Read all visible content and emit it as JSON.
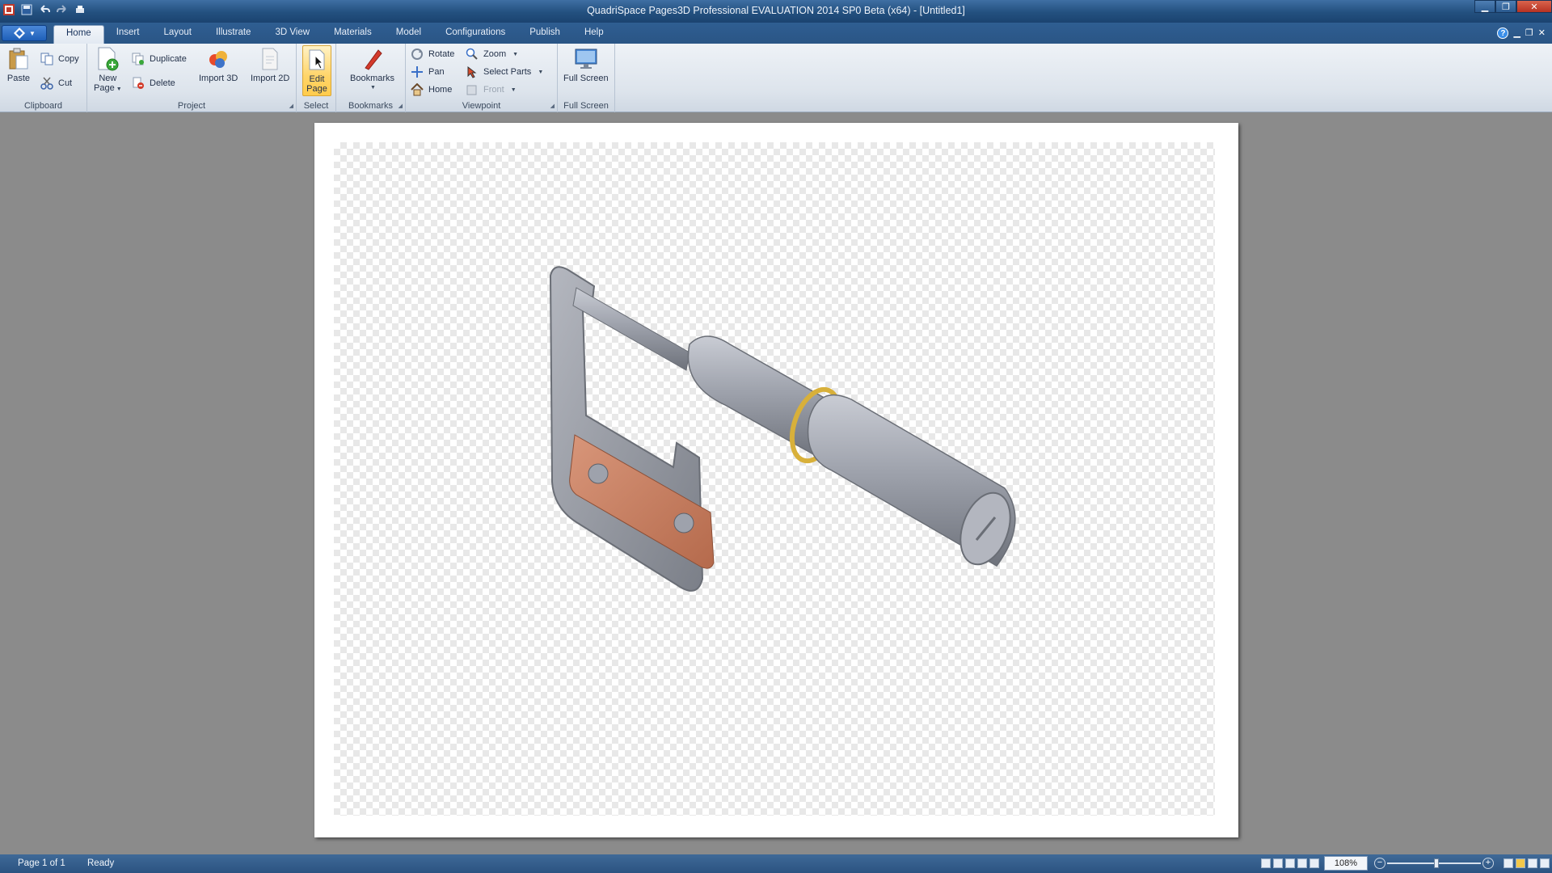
{
  "window": {
    "title": "QuadriSpace Pages3D Professional EVALUATION 2014 SP0 Beta (x64) - [Untitled1]"
  },
  "quick_access": [
    "app-logo-icon",
    "save-icon",
    "undo-icon",
    "redo-icon",
    "print-icon"
  ],
  "menu": {
    "tabs": [
      "Home",
      "Insert",
      "Layout",
      "Illustrate",
      "3D View",
      "Materials",
      "Model",
      "Configurations",
      "Publish",
      "Help"
    ],
    "active_tab": "Home"
  },
  "ribbon": {
    "clipboard": {
      "label": "Clipboard",
      "paste": "Paste",
      "copy": "Copy",
      "cut": "Cut"
    },
    "project": {
      "label": "Project",
      "new_page_1": "New",
      "new_page_2": "Page",
      "duplicate": "Duplicate",
      "delete": "Delete",
      "import3d": "Import 3D",
      "import2d": "Import 2D"
    },
    "select": {
      "label": "Select",
      "edit_page_1": "Edit",
      "edit_page_2": "Page"
    },
    "bookmarks": {
      "label": "Bookmarks",
      "bookmarks": "Bookmarks"
    },
    "viewpoint": {
      "label": "Viewpoint",
      "rotate": "Rotate",
      "pan": "Pan",
      "home": "Home",
      "zoom": "Zoom",
      "select_parts": "Select Parts",
      "front": "Front"
    },
    "fullscreen": {
      "label": "Full Screen",
      "full_screen": "Full Screen"
    }
  },
  "colors": {
    "title_bar": "#2a5888",
    "ribbon_bg": "#dfe6ee",
    "active_tool": "#ffd56a",
    "workspace_bg": "#8b8b8b",
    "status_bar": "#34608f"
  },
  "statusbar": {
    "page_info": "Page 1 of 1",
    "status": "Ready",
    "zoom": "108%"
  }
}
